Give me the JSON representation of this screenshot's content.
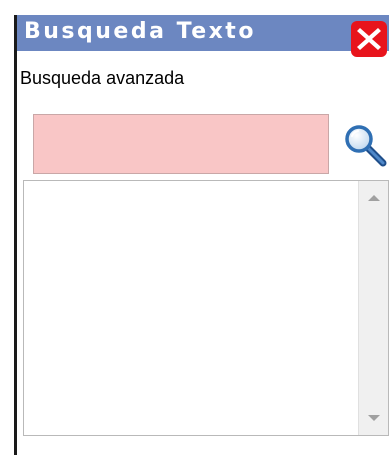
{
  "window": {
    "title": "Busqueda Texto",
    "close_icon": "close-x-icon"
  },
  "subtitle": "Busqueda avanzada",
  "search": {
    "value": "",
    "placeholder": "",
    "button_icon": "magnifier-icon"
  },
  "results": {
    "items": []
  },
  "colors": {
    "titlebar": "#6c87c1",
    "close": "#e8141c",
    "input_bg": "#f9c6c6"
  }
}
